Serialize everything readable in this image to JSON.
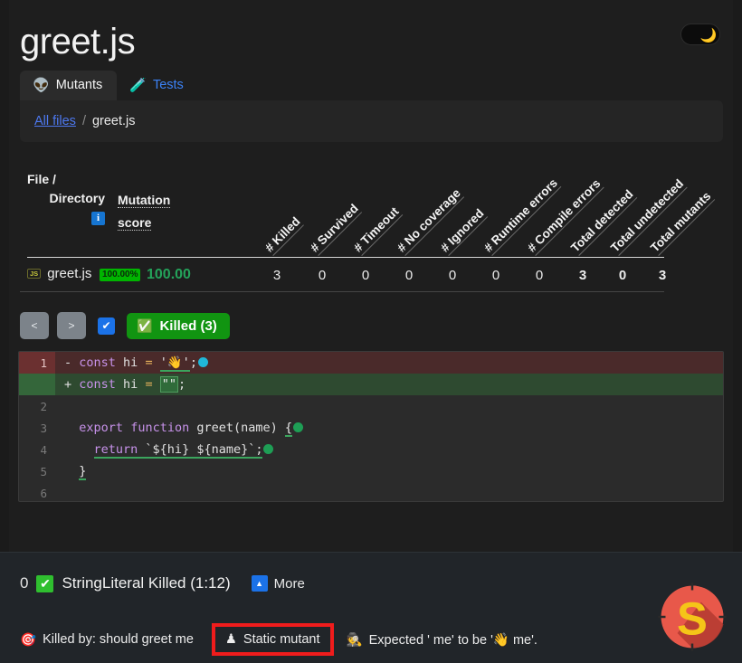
{
  "header": {
    "title": "greet.js",
    "theme_toggle": {
      "icon": "moon-icon",
      "glyph": "🌙",
      "state": "dark"
    }
  },
  "tabs": [
    {
      "label": "Mutants",
      "icon": "alien-icon",
      "glyph": "👽",
      "active": true
    },
    {
      "label": "Tests",
      "icon": "test-tube-icon",
      "glyph": "🧪",
      "active": false
    }
  ],
  "breadcrumb": {
    "root": "All files",
    "separator": "/",
    "current": "greet.js"
  },
  "table": {
    "col_file": {
      "line1": "File /",
      "line2": "Directory",
      "info_glyph": "i"
    },
    "col_score": {
      "line1": "Mutation",
      "line2": "score"
    },
    "rotated_headers": [
      "# Killed",
      "# Survived",
      "# Timeout",
      "# No coverage",
      "# Ignored",
      "# Runtime errors",
      "# Compile errors",
      "Total detected",
      "Total undetected",
      "Total mutants"
    ],
    "rows": [
      {
        "file": "greet.js",
        "file_type": "JS",
        "score_badge": "100.00%",
        "score": "100.00",
        "values": [
          "3",
          "0",
          "0",
          "0",
          "0",
          "0",
          "0"
        ],
        "totals": [
          "3",
          "0",
          "3"
        ]
      }
    ]
  },
  "toolbar": {
    "prev_label": "<",
    "next_label": ">",
    "checkbox_glyph": "✔",
    "filter": {
      "label": "Killed (3)",
      "icon": "check-box-icon",
      "glyph": "✅",
      "color": "#119411"
    }
  },
  "code": {
    "lines": [
      {
        "no": "1",
        "kind": "del",
        "sign": "-",
        "text": "const hi = '👋';",
        "marker": "cyan"
      },
      {
        "no": "",
        "kind": "add",
        "sign": "+",
        "text": "const hi = \"\";",
        "marker": "none"
      },
      {
        "no": "2",
        "kind": "ctx",
        "text": "",
        "marker": "none"
      },
      {
        "no": "3",
        "kind": "ctx",
        "text": "export function greet(name) {",
        "marker": "green"
      },
      {
        "no": "4",
        "kind": "ctx",
        "text": "  return `${hi} ${name}`;",
        "marker": "green"
      },
      {
        "no": "5",
        "kind": "ctx",
        "text": "}",
        "marker": "none"
      },
      {
        "no": "6",
        "kind": "ctx",
        "text": "",
        "marker": "none"
      }
    ]
  },
  "drawer": {
    "index": "0",
    "status_glyph": "✔",
    "headline": "StringLiteral Killed (1:12)",
    "more_label": "More",
    "more_glyph": "▲",
    "meta": [
      {
        "icon": "target-icon",
        "glyph": "🎯",
        "text": "Killed by: should greet me",
        "boxed": false
      },
      {
        "icon": "chess-pawn-icon",
        "glyph": "♟",
        "text": "Static mutant",
        "boxed": true
      },
      {
        "icon": "detective-icon",
        "glyph": "🕵️",
        "text": "Expected ' me' to be '👋 me'.",
        "boxed": false
      }
    ]
  },
  "logo": {
    "name": "stryker-logo",
    "letter": "S"
  }
}
